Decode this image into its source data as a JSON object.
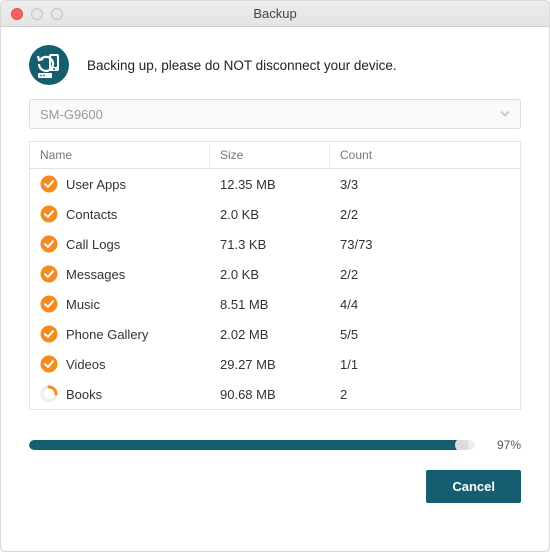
{
  "window": {
    "title": "Backup"
  },
  "header": {
    "message": "Backing up, please do NOT disconnect your device."
  },
  "device": {
    "selected": "SM-G9600"
  },
  "table": {
    "columns": {
      "name": "Name",
      "size": "Size",
      "count": "Count"
    },
    "rows": [
      {
        "name": "User Apps",
        "size": "12.35 MB",
        "count": "3/3",
        "status": "done"
      },
      {
        "name": "Contacts",
        "size": "2.0 KB",
        "count": "2/2",
        "status": "done"
      },
      {
        "name": "Call Logs",
        "size": "71.3 KB",
        "count": "73/73",
        "status": "done"
      },
      {
        "name": "Messages",
        "size": "2.0 KB",
        "count": "2/2",
        "status": "done"
      },
      {
        "name": "Music",
        "size": "8.51 MB",
        "count": "4/4",
        "status": "done"
      },
      {
        "name": "Phone Gallery",
        "size": "2.02 MB",
        "count": "5/5",
        "status": "done"
      },
      {
        "name": "Videos",
        "size": "29.27 MB",
        "count": "1/1",
        "status": "done"
      },
      {
        "name": "Books",
        "size": "90.68 MB",
        "count": "2",
        "status": "progress"
      }
    ]
  },
  "progress": {
    "percent": 97,
    "label": "97%"
  },
  "buttons": {
    "cancel": "Cancel"
  },
  "colors": {
    "accent": "#155e6f",
    "check": "#f58b1f"
  }
}
